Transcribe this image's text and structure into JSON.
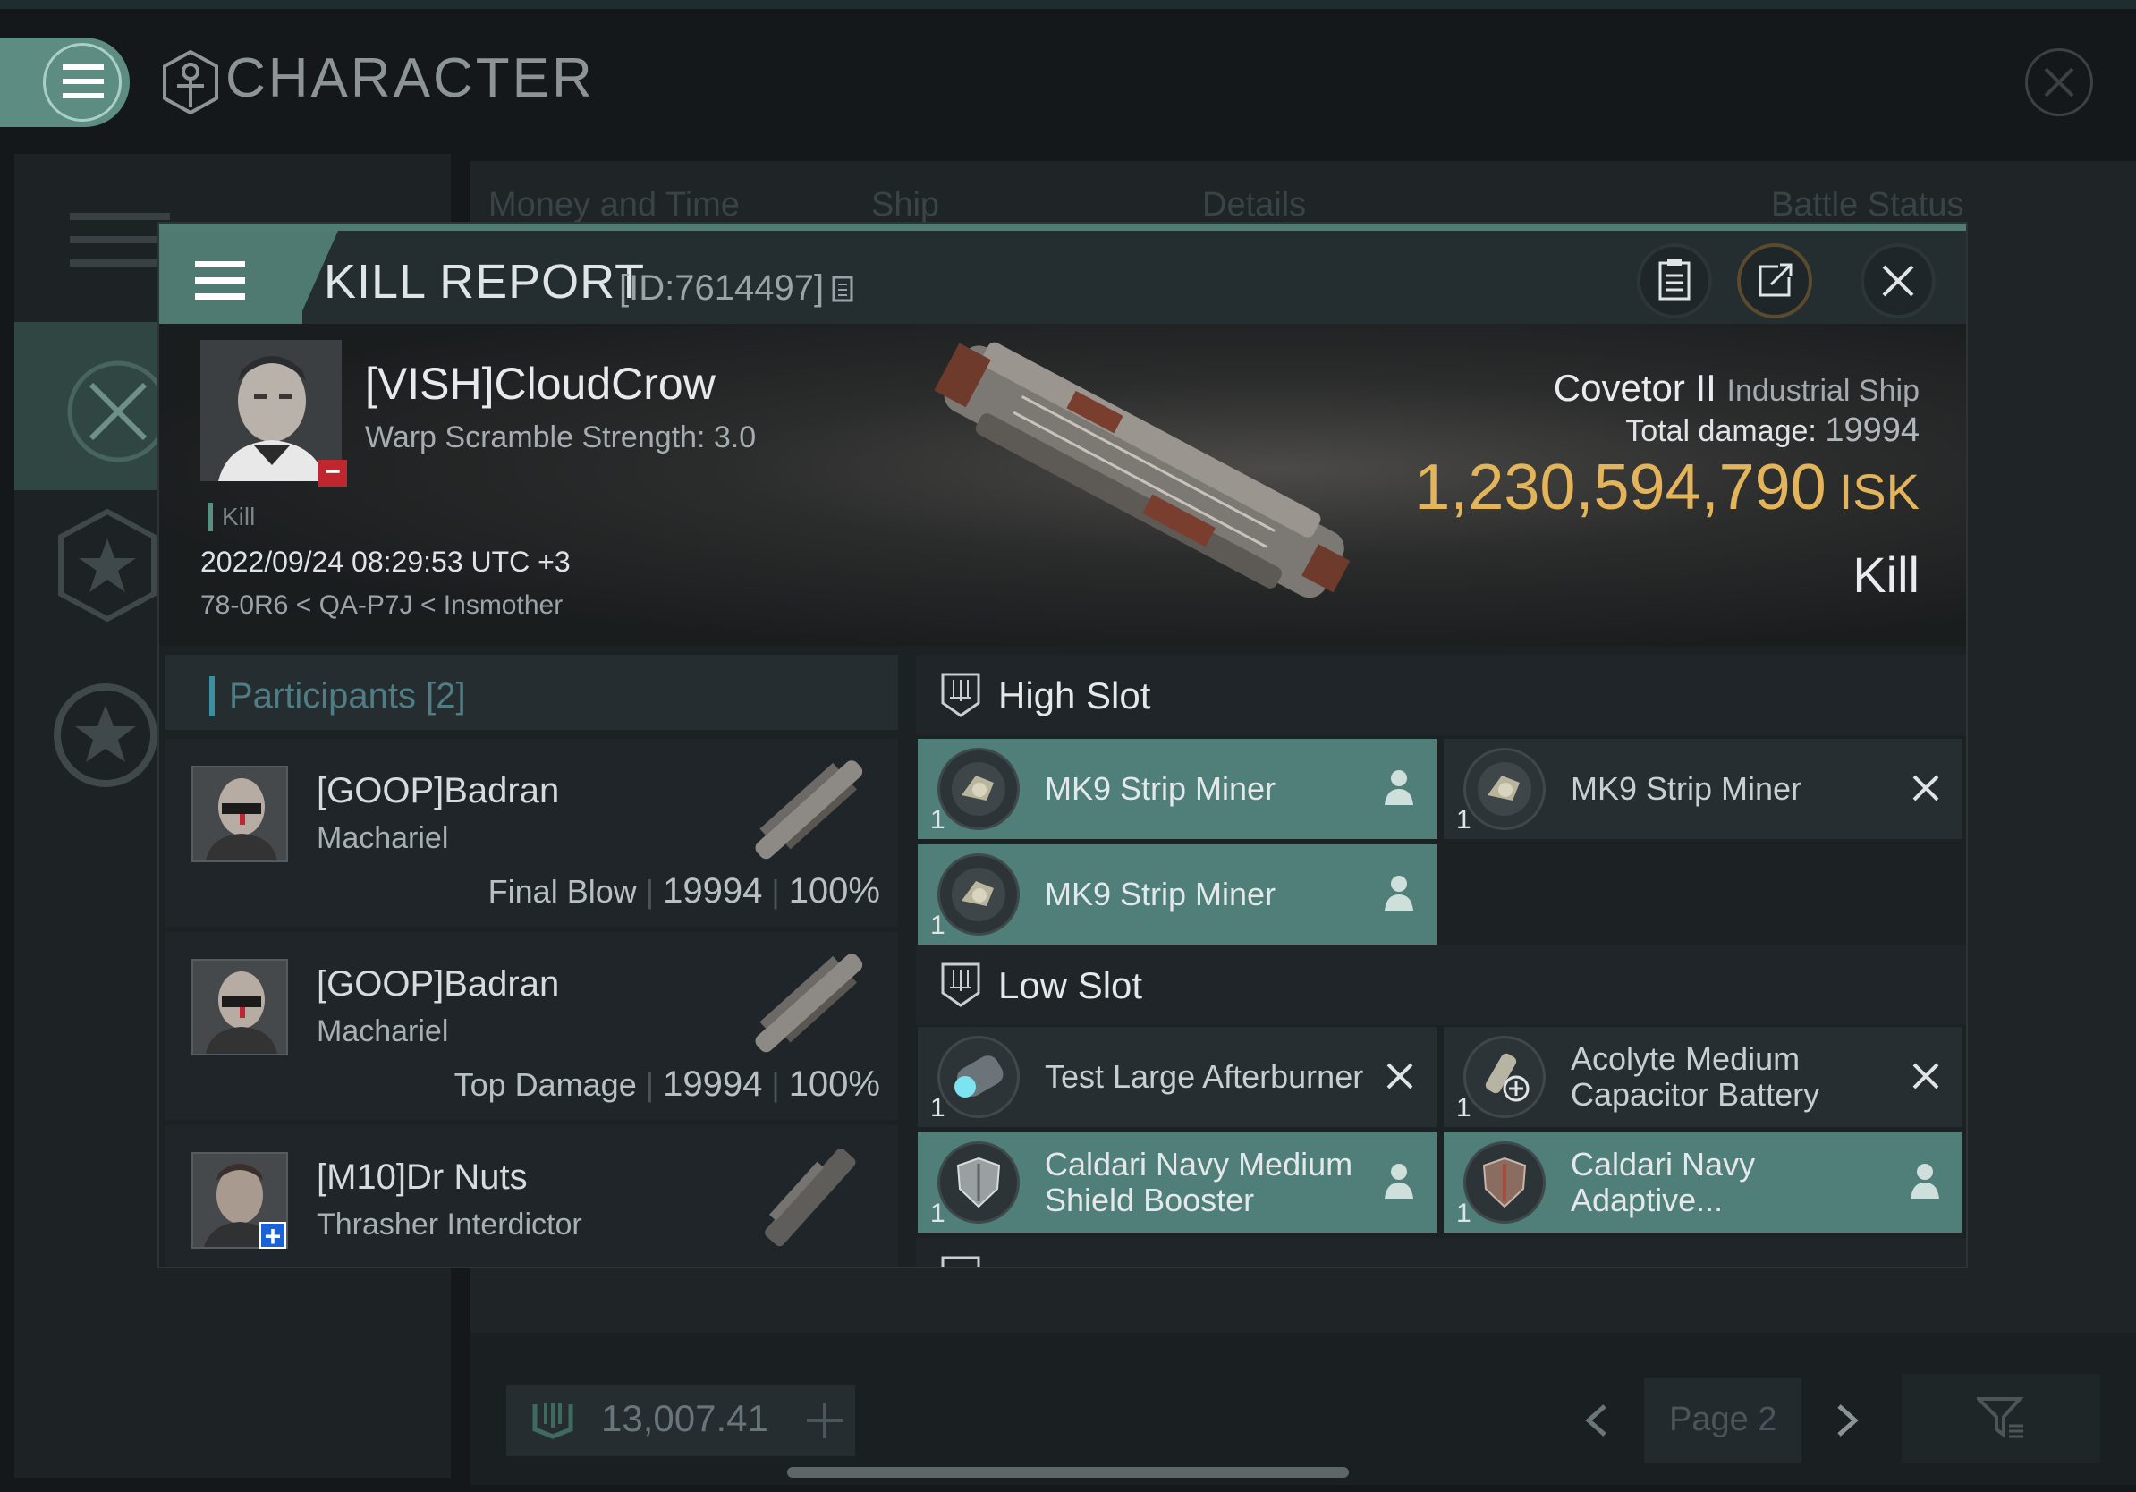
{
  "app": {
    "title": "CHARACTER",
    "bg_tabs": [
      "Money and Time",
      "Ship",
      "Details",
      "Battle Status"
    ],
    "balance": "13,007.41",
    "page": "Page 2"
  },
  "modal": {
    "title": "KILL REPORT",
    "id_label": "[ID:7614497]"
  },
  "victim": {
    "name": "[VISH]CloudCrow",
    "subtitle": "Warp Scramble Strength: 3.0",
    "tag": "Kill",
    "datetime": "2022/09/24 08:29:53 UTC +3",
    "location": "78-0R6 < QA-P7J < Insmother",
    "ship_name": "Covetor II",
    "ship_class": "Industrial Ship",
    "total_damage_label": "Total damage:",
    "total_damage": "19994",
    "isk_value": "1,230,594,790",
    "isk_unit": "ISK",
    "result": "Kill"
  },
  "participants": {
    "label": "Participants",
    "count": "[2]",
    "rows": [
      {
        "name": "[GOOP]Badran",
        "ship": "Machariel",
        "role": "Final Blow",
        "damage": "19994",
        "percent": "100%",
        "badge": ""
      },
      {
        "name": "[GOOP]Badran",
        "ship": "Machariel",
        "role": "Top Damage",
        "damage": "19994",
        "percent": "100%",
        "badge": ""
      },
      {
        "name": "[M10]Dr Nuts",
        "ship": "Thrasher Interdictor",
        "role": "",
        "damage": "",
        "percent": "",
        "badge": "+"
      }
    ]
  },
  "slots": {
    "high": {
      "label": "High Slot",
      "items": [
        {
          "name": "MK9 Strip Miner",
          "qty": "1",
          "status": "dropped"
        },
        {
          "name": "MK9 Strip Miner",
          "qty": "1",
          "status": "destroyed"
        },
        {
          "name": "MK9 Strip Miner",
          "qty": "1",
          "status": "dropped"
        }
      ]
    },
    "low": {
      "label": "Low Slot",
      "items": [
        {
          "name": "Test Large Afterburner",
          "qty": "1",
          "status": "destroyed"
        },
        {
          "name": "Acolyte Medium Capacitor Battery",
          "qty": "1",
          "status": "destroyed"
        },
        {
          "name": "Caldari Navy Medium Shield Booster",
          "qty": "1",
          "status": "dropped"
        },
        {
          "name": "Caldari Navy Adaptive...",
          "qty": "1",
          "status": "dropped"
        }
      ]
    }
  },
  "colors": {
    "accent_teal": "#4f7f78",
    "isk_gold": "#e3b45a",
    "negative_red": "#c0262d",
    "positive_blue": "#1a62d8"
  },
  "icons": [
    "menu-icon",
    "character-icon",
    "copy-icon",
    "clipboard-icon",
    "share-icon",
    "close-icon",
    "pilot-icon",
    "x-icon"
  ]
}
